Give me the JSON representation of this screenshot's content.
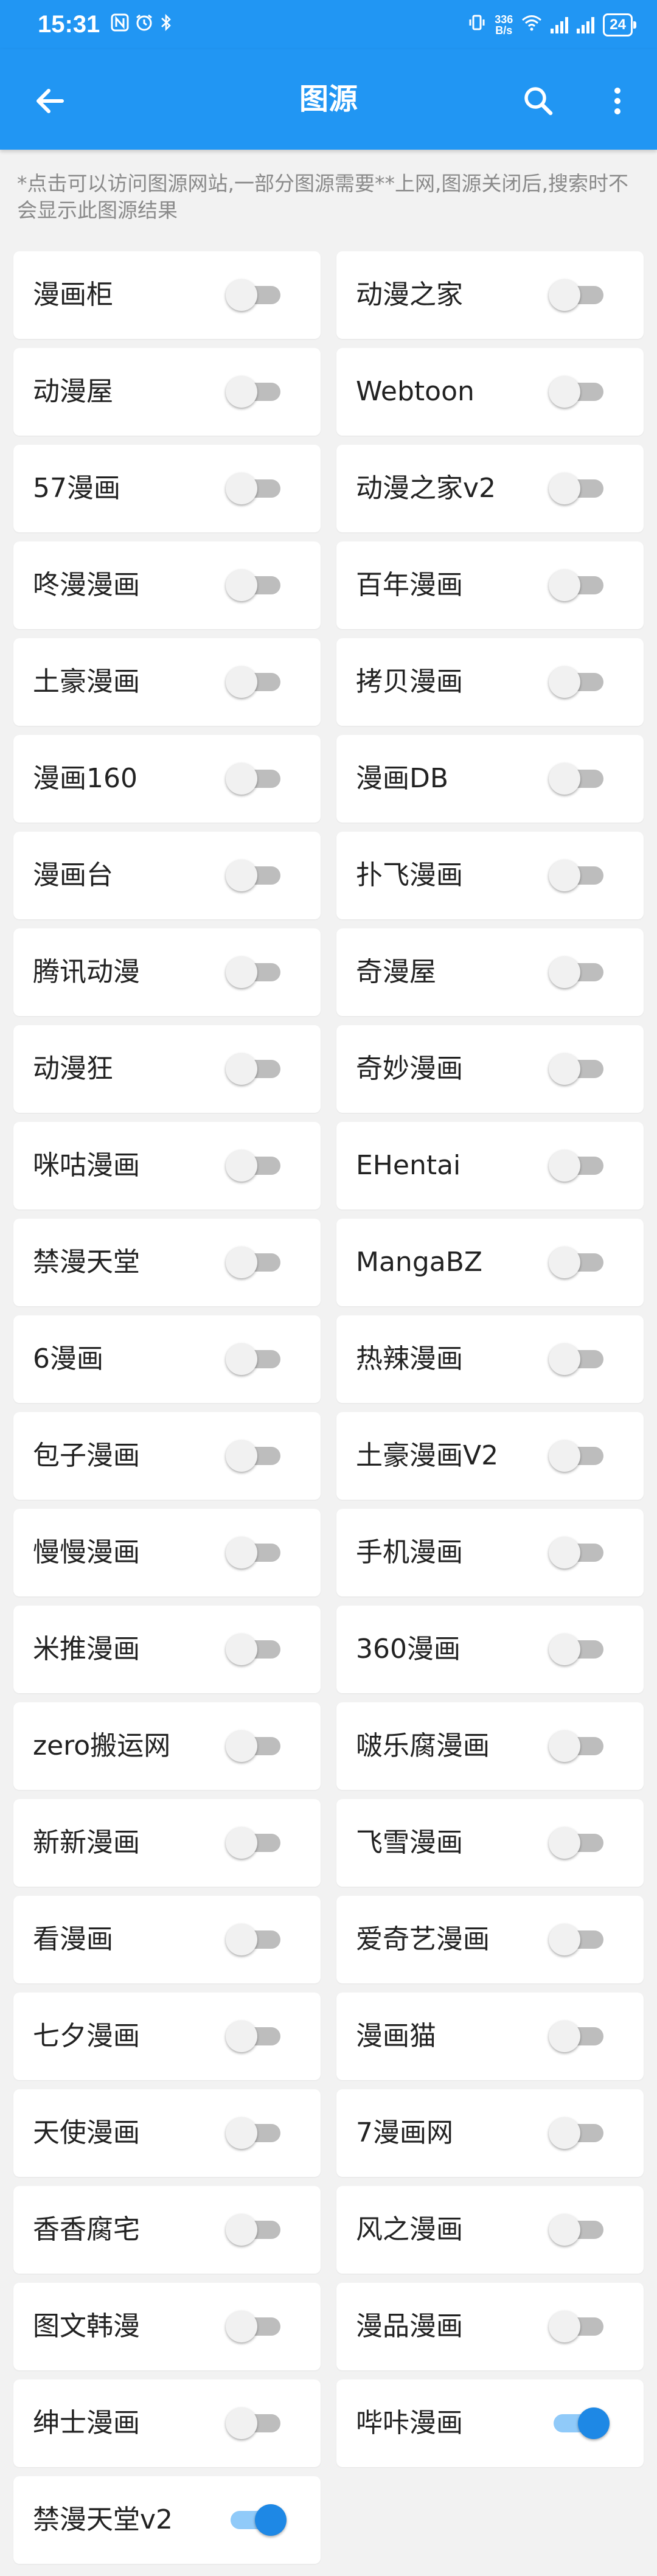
{
  "status_bar": {
    "time": "15:31",
    "net_speed_value": "336",
    "net_speed_unit": "B/s",
    "battery": "24"
  },
  "app_bar": {
    "title": "图源"
  },
  "note": "*点击可以访问图源网站,一部分图源需要**上网,图源关闭后,搜索时不会显示此图源结果",
  "colors": {
    "primary": "#2196f3",
    "switch_on": "#1e88e5",
    "background": "#f2f2f2"
  },
  "sources": [
    {
      "name": "漫画柜",
      "enabled": false
    },
    {
      "name": "动漫之家",
      "enabled": false
    },
    {
      "name": "动漫屋",
      "enabled": false
    },
    {
      "name": "Webtoon",
      "enabled": false
    },
    {
      "name": "57漫画",
      "enabled": false
    },
    {
      "name": "动漫之家v2",
      "enabled": false
    },
    {
      "name": "咚漫漫画",
      "enabled": false
    },
    {
      "name": "百年漫画",
      "enabled": false
    },
    {
      "name": "土豪漫画",
      "enabled": false
    },
    {
      "name": "拷贝漫画",
      "enabled": false
    },
    {
      "name": "漫画160",
      "enabled": false
    },
    {
      "name": "漫画DB",
      "enabled": false
    },
    {
      "name": "漫画台",
      "enabled": false
    },
    {
      "name": "扑飞漫画",
      "enabled": false
    },
    {
      "name": "腾讯动漫",
      "enabled": false
    },
    {
      "name": "奇漫屋",
      "enabled": false
    },
    {
      "name": "动漫狂",
      "enabled": false
    },
    {
      "name": "奇妙漫画",
      "enabled": false
    },
    {
      "name": "咪咕漫画",
      "enabled": false
    },
    {
      "name": "EHentai",
      "enabled": false
    },
    {
      "name": "禁漫天堂",
      "enabled": false
    },
    {
      "name": "MangaBZ",
      "enabled": false
    },
    {
      "name": "6漫画",
      "enabled": false
    },
    {
      "name": "热辣漫画",
      "enabled": false
    },
    {
      "name": "包子漫画",
      "enabled": false
    },
    {
      "name": "土豪漫画V2",
      "enabled": false
    },
    {
      "name": "慢慢漫画",
      "enabled": false
    },
    {
      "name": "手机漫画",
      "enabled": false
    },
    {
      "name": "米推漫画",
      "enabled": false
    },
    {
      "name": "360漫画",
      "enabled": false
    },
    {
      "name": "zero搬运网",
      "enabled": false
    },
    {
      "name": "啵乐腐漫画",
      "enabled": false
    },
    {
      "name": "新新漫画",
      "enabled": false
    },
    {
      "name": "飞雪漫画",
      "enabled": false
    },
    {
      "name": "看漫画",
      "enabled": false
    },
    {
      "name": "爱奇艺漫画",
      "enabled": false
    },
    {
      "name": "七夕漫画",
      "enabled": false
    },
    {
      "name": "漫画猫",
      "enabled": false
    },
    {
      "name": "天使漫画",
      "enabled": false
    },
    {
      "name": "7漫画网",
      "enabled": false
    },
    {
      "name": "香香腐宅",
      "enabled": false
    },
    {
      "name": "风之漫画",
      "enabled": false
    },
    {
      "name": "图文韩漫",
      "enabled": false
    },
    {
      "name": "漫品漫画",
      "enabled": false
    },
    {
      "name": "绅士漫画",
      "enabled": false
    },
    {
      "name": "哔咔漫画",
      "enabled": true
    },
    {
      "name": "禁漫天堂v2",
      "enabled": true
    }
  ]
}
